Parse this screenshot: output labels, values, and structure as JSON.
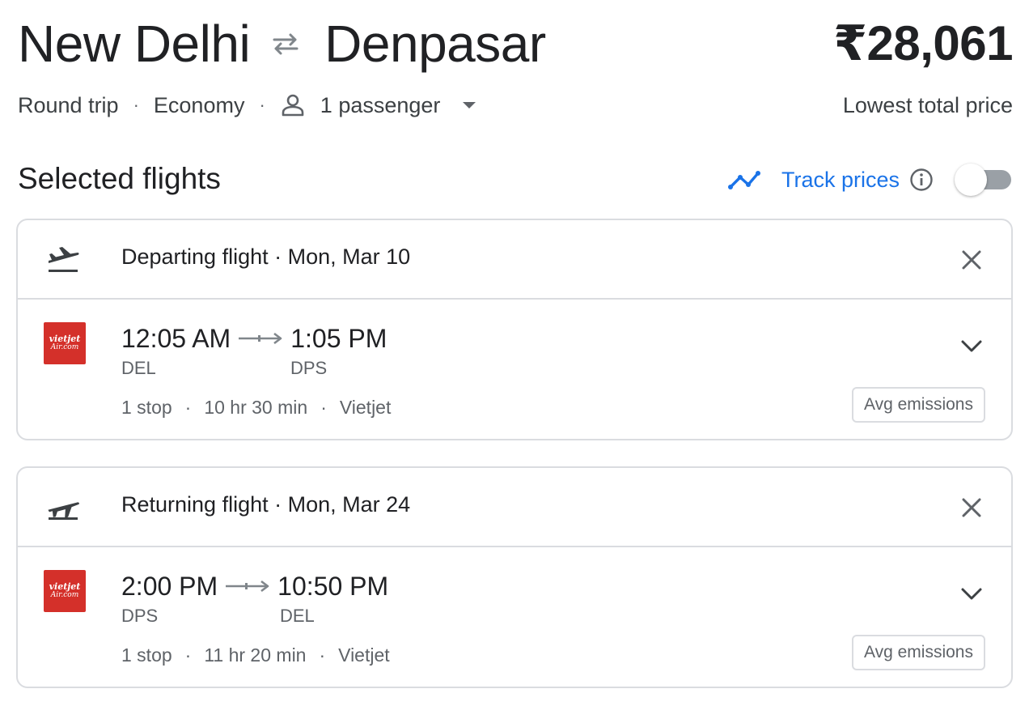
{
  "header": {
    "origin": "New Delhi",
    "destination": "Denpasar",
    "price": "₹28,061",
    "price_caption": "Lowest total price",
    "trip_type": "Round trip",
    "cabin_class": "Economy",
    "passengers": "1 passenger"
  },
  "selected": {
    "title": "Selected flights",
    "track_prices_label": "Track prices",
    "track_prices_enabled": false,
    "accent_color": "#1a73e8"
  },
  "flights": [
    {
      "heading": "Departing flight · Mon, Mar 10",
      "airline_logo_top": "vietjet",
      "airline_logo_bottom": "Air.com",
      "depart_time": "12:05 AM",
      "arrive_time": "1:05 PM",
      "depart_airport": "DEL",
      "arrive_airport": "DPS",
      "stops": "1 stop",
      "duration": "10 hr 30 min",
      "airline": "Vietjet",
      "emissions": "Avg emissions"
    },
    {
      "heading": "Returning flight · Mon, Mar 24",
      "airline_logo_top": "vietjet",
      "airline_logo_bottom": "Air.com",
      "depart_time": "2:00 PM",
      "arrive_time": "10:50 PM",
      "depart_airport": "DPS",
      "arrive_airport": "DEL",
      "stops": "1 stop",
      "duration": "11 hr 20 min",
      "airline": "Vietjet",
      "emissions": "Avg emissions"
    }
  ],
  "separators": {
    "dot": "·"
  },
  "icons": [
    "swap-arrows-icon",
    "person-icon",
    "dropdown-caret-icon",
    "trend-line-icon",
    "info-icon",
    "takeoff-icon",
    "landing-icon",
    "close-icon",
    "chevron-down-icon",
    "arrow-right-icon"
  ],
  "colors": {
    "airline_brand": "#d4302a",
    "text": "#202124",
    "muted": "#5f6368",
    "border": "#dadce0"
  }
}
